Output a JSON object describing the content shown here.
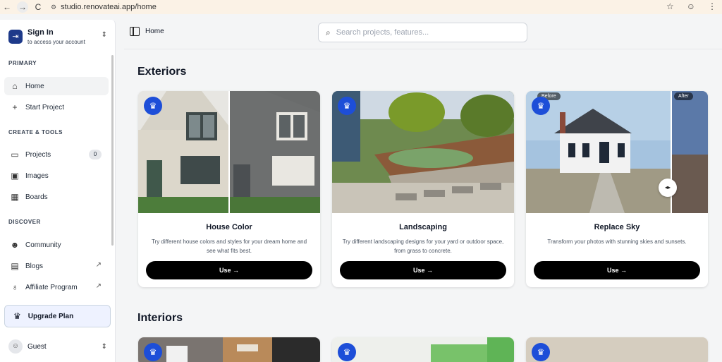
{
  "browser": {
    "url": "studio.renovateai.app/home",
    "back_icon": "←",
    "forward_icon": "→",
    "reload_icon": "C",
    "site_icon": "⚙",
    "star_icon": "☆",
    "profile_icon": "☺",
    "menu_icon": "⋮"
  },
  "sidebar": {
    "signin": {
      "title": "Sign In",
      "subtitle": "to access your account"
    },
    "sections": {
      "primary": "PRIMARY",
      "create": "CREATE & TOOLS",
      "discover": "DISCOVER"
    },
    "items": {
      "home": "Home",
      "start_project": "Start Project",
      "projects": "Projects",
      "projects_count": "0",
      "images": "Images",
      "boards": "Boards",
      "community": "Community",
      "blogs": "Blogs",
      "affiliate": "Affiliate Program"
    },
    "upgrade": "Upgrade Plan",
    "guest": "Guest"
  },
  "topbar": {
    "home": "Home",
    "search_placeholder": "Search projects, features..."
  },
  "sections": {
    "exteriors": "Exteriors",
    "interiors": "Interiors"
  },
  "cards": [
    {
      "title": "House Color",
      "desc": "Try different house colors and styles for your dream home and see what fits best.",
      "button": "Use →"
    },
    {
      "title": "Landscaping",
      "desc": "Try different landscaping designs for your yard or outdoor space, from grass to concrete.",
      "button": "Use →"
    },
    {
      "title": "Replace Sky",
      "desc": "Transform your photos with stunning skies and sunsets.",
      "button": "Use →",
      "before": "Before",
      "after": "After"
    }
  ],
  "colors": {
    "accent": "#1d4ed8",
    "button": "#000000",
    "upgrade_bg": "#eef2ff"
  }
}
